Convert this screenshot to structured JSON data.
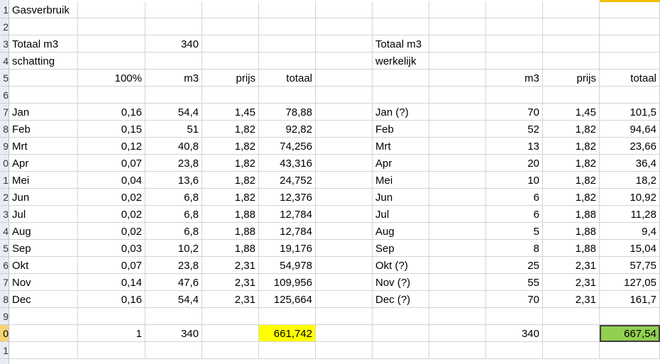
{
  "sheet": {
    "row_numbers": [
      "1",
      "2",
      "3",
      "4",
      "5",
      "6",
      "7",
      "8",
      "9",
      "0",
      "1",
      "2",
      "3",
      "4",
      "5",
      "6",
      "7",
      "8",
      "9",
      "0",
      "1"
    ],
    "selected_row_index": 19,
    "title": "Gasverbruik",
    "left": {
      "total_label": "Totaal m3",
      "total_value": "340",
      "subtitle": "schatting",
      "headers": {
        "pct": "100%",
        "m3": "m3",
        "prijs": "prijs",
        "totaal": "totaal"
      },
      "rows": [
        {
          "month": "Jan",
          "pct": "0,16",
          "m3": "54,4",
          "prijs": "1,45",
          "totaal": "78,88"
        },
        {
          "month": "Feb",
          "pct": "0,15",
          "m3": "51",
          "prijs": "1,82",
          "totaal": "92,82"
        },
        {
          "month": "Mrt",
          "pct": "0,12",
          "m3": "40,8",
          "prijs": "1,82",
          "totaal": "74,256"
        },
        {
          "month": "Apr",
          "pct": "0,07",
          "m3": "23,8",
          "prijs": "1,82",
          "totaal": "43,316"
        },
        {
          "month": "Mei",
          "pct": "0,04",
          "m3": "13,6",
          "prijs": "1,82",
          "totaal": "24,752"
        },
        {
          "month": "Jun",
          "pct": "0,02",
          "m3": "6,8",
          "prijs": "1,82",
          "totaal": "12,376"
        },
        {
          "month": "Jul",
          "pct": "0,02",
          "m3": "6,8",
          "prijs": "1,88",
          "totaal": "12,784"
        },
        {
          "month": "Aug",
          "pct": "0,02",
          "m3": "6,8",
          "prijs": "1,88",
          "totaal": "12,784"
        },
        {
          "month": "Sep",
          "pct": "0,03",
          "m3": "10,2",
          "prijs": "1,88",
          "totaal": "19,176"
        },
        {
          "month": "Okt",
          "pct": "0,07",
          "m3": "23,8",
          "prijs": "2,31",
          "totaal": "54,978"
        },
        {
          "month": "Nov",
          "pct": "0,14",
          "m3": "47,6",
          "prijs": "2,31",
          "totaal": "109,956"
        },
        {
          "month": "Dec",
          "pct": "0,16",
          "m3": "54,4",
          "prijs": "2,31",
          "totaal": "125,664"
        }
      ],
      "sum": {
        "pct": "1",
        "m3": "340",
        "totaal": "661,742"
      }
    },
    "right": {
      "total_label": "Totaal m3",
      "subtitle": "werkelijk",
      "headers": {
        "m3": "m3",
        "prijs": "prijs",
        "totaal": "totaal"
      },
      "rows": [
        {
          "month": "Jan (?)",
          "m3": "70",
          "prijs": "1,45",
          "totaal": "101,5"
        },
        {
          "month": "Feb",
          "m3": "52",
          "prijs": "1,82",
          "totaal": "94,64"
        },
        {
          "month": "Mrt",
          "m3": "13",
          "prijs": "1,82",
          "totaal": "23,66"
        },
        {
          "month": "Apr",
          "m3": "20",
          "prijs": "1,82",
          "totaal": "36,4"
        },
        {
          "month": "Mei",
          "m3": "10",
          "prijs": "1,82",
          "totaal": "18,2"
        },
        {
          "month": "Jun",
          "m3": "6",
          "prijs": "1,82",
          "totaal": "10,92"
        },
        {
          "month": "Jul",
          "m3": "6",
          "prijs": "1,88",
          "totaal": "11,28"
        },
        {
          "month": "Aug",
          "m3": "5",
          "prijs": "1,88",
          "totaal": "9,4"
        },
        {
          "month": "Sep",
          "m3": "8",
          "prijs": "1,88",
          "totaal": "15,04"
        },
        {
          "month": "Okt (?)",
          "m3": "25",
          "prijs": "2,31",
          "totaal": "57,75"
        },
        {
          "month": "Nov (?)",
          "m3": "55",
          "prijs": "2,31",
          "totaal": "127,05"
        },
        {
          "month": "Dec (?)",
          "m3": "70",
          "prijs": "2,31",
          "totaal": "161,7"
        }
      ],
      "sum": {
        "m3": "340",
        "totaal": "667,54"
      }
    },
    "colors": {
      "highlight_yellow": "#ffff00",
      "highlight_green": "#92d050"
    }
  }
}
